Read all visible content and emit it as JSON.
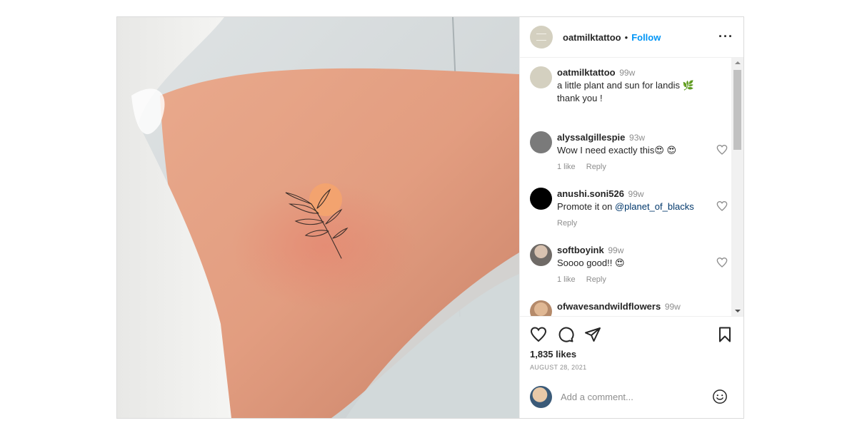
{
  "post": {
    "username": "oatmilktattoo",
    "separator": "•",
    "follow_label": "Follow",
    "more_icon": "more-horizontal-icon"
  },
  "caption": {
    "username": "oatmilktattoo",
    "time": "99w",
    "line1": "a little plant and sun for landis 🌿",
    "line2": "thank you !"
  },
  "comments": [
    {
      "username": "alyssalgillespie",
      "time": "93w",
      "text": "Wow I need exactly this😍 😍",
      "likes": "1 like",
      "reply": "Reply",
      "avatar_color": "#7a7a7a"
    },
    {
      "username": "anushi.soni526",
      "time": "99w",
      "text_prefix": "Promote it on ",
      "mention": "@planet_of_blacks",
      "reply": "Reply",
      "avatar_color": "#000000"
    },
    {
      "username": "softboyink",
      "time": "99w",
      "text": "Soooo good!! 😍",
      "likes": "1 like",
      "reply": "Reply",
      "avatar_color": "#9a8f86"
    },
    {
      "username": "ofwavesandwildflowers",
      "time": "99w",
      "avatar_color": "#c9a27f"
    }
  ],
  "actions": {
    "like_icon": "heart-icon",
    "comment_icon": "comment-icon",
    "share_icon": "send-icon",
    "save_icon": "bookmark-icon"
  },
  "likes_text": "1,835 likes",
  "date_text": "AUGUST 28, 2021",
  "add_comment": {
    "placeholder": "Add a comment...",
    "emoji_icon": "smiley-icon"
  },
  "colors": {
    "follow_blue": "#0095f6",
    "mention_blue": "#00376b",
    "secondary_text": "#8e8e8e",
    "sun_orange": "#f4a46e"
  }
}
